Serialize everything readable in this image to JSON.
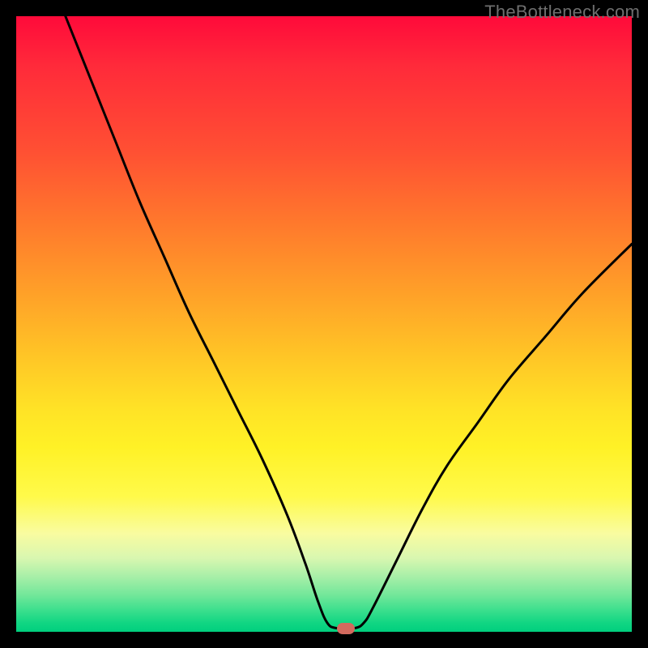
{
  "watermark": "TheBottleneck.com",
  "chart_data": {
    "type": "line",
    "title": "",
    "xlabel": "",
    "ylabel": "",
    "xlim": [
      0,
      100
    ],
    "ylim": [
      0,
      100
    ],
    "grid": false,
    "legend": false,
    "series": [
      {
        "name": "bottleneck-curve",
        "x": [
          8,
          12,
          16,
          20,
          24,
          28,
          32,
          36,
          40,
          44,
          47,
          49,
          50.5,
          52,
          55,
          56.5,
          58,
          62,
          66,
          70,
          75,
          80,
          86,
          92,
          100
        ],
        "values": [
          100,
          90,
          80,
          70,
          61,
          52,
          44,
          36,
          28,
          19,
          11,
          5,
          1.5,
          0.6,
          0.6,
          1.5,
          4,
          12,
          20,
          27,
          34,
          41,
          48,
          55,
          63
        ]
      }
    ],
    "marker": {
      "x": 53.5,
      "y": 0.5,
      "color": "#d36a5e"
    },
    "background_gradient_stops": [
      {
        "pos": 0,
        "color": "#ff0a3a"
      },
      {
        "pos": 0.5,
        "color": "#ffc826"
      },
      {
        "pos": 0.82,
        "color": "#fffa4a"
      },
      {
        "pos": 1.0,
        "color": "#00cf7e"
      }
    ]
  }
}
